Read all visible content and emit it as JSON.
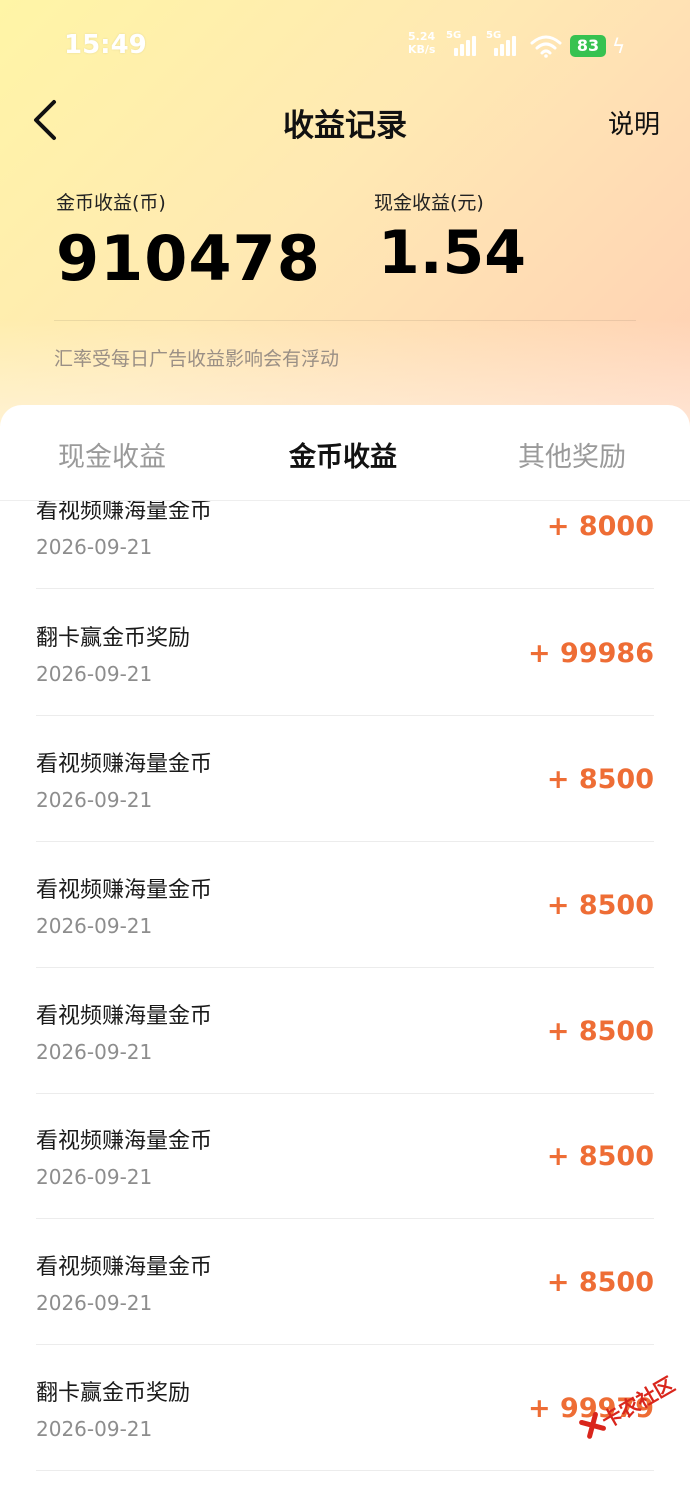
{
  "status": {
    "time": "15:49",
    "net_speed_value": "5.24",
    "net_speed_unit": "KB/s",
    "sim1_tag": "5G",
    "sim2_tag": "5G",
    "battery": "83"
  },
  "header": {
    "title": "收益记录",
    "explain": "说明"
  },
  "summary": {
    "gold_label": "金币收益(币)",
    "gold_value": "910478",
    "cash_label": "现金收益(元)",
    "cash_value": "1.54",
    "note": "汇率受每日广告收益影响会有浮动"
  },
  "tabs": [
    {
      "label": "现金收益",
      "active": false
    },
    {
      "label": "金币收益",
      "active": true
    },
    {
      "label": "其他奖励",
      "active": false
    }
  ],
  "records": [
    {
      "name": "看视频赚海量金币",
      "date": "2026-09-21",
      "amount": "+ 8000"
    },
    {
      "name": "翻卡赢金币奖励",
      "date": "2026-09-21",
      "amount": "+ 99986"
    },
    {
      "name": "看视频赚海量金币",
      "date": "2026-09-21",
      "amount": "+ 8500"
    },
    {
      "name": "看视频赚海量金币",
      "date": "2026-09-21",
      "amount": "+ 8500"
    },
    {
      "name": "看视频赚海量金币",
      "date": "2026-09-21",
      "amount": "+ 8500"
    },
    {
      "name": "看视频赚海量金币",
      "date": "2026-09-21",
      "amount": "+ 8500"
    },
    {
      "name": "看视频赚海量金币",
      "date": "2026-09-21",
      "amount": "+ 8500"
    },
    {
      "name": "翻卡赢金币奖励",
      "date": "2026-09-21",
      "amount": "+ 99979"
    }
  ],
  "watermark": "卡农社区",
  "colors": {
    "amount": "#ee6d35",
    "battery": "#37c251",
    "watermark": "#d9261c"
  }
}
